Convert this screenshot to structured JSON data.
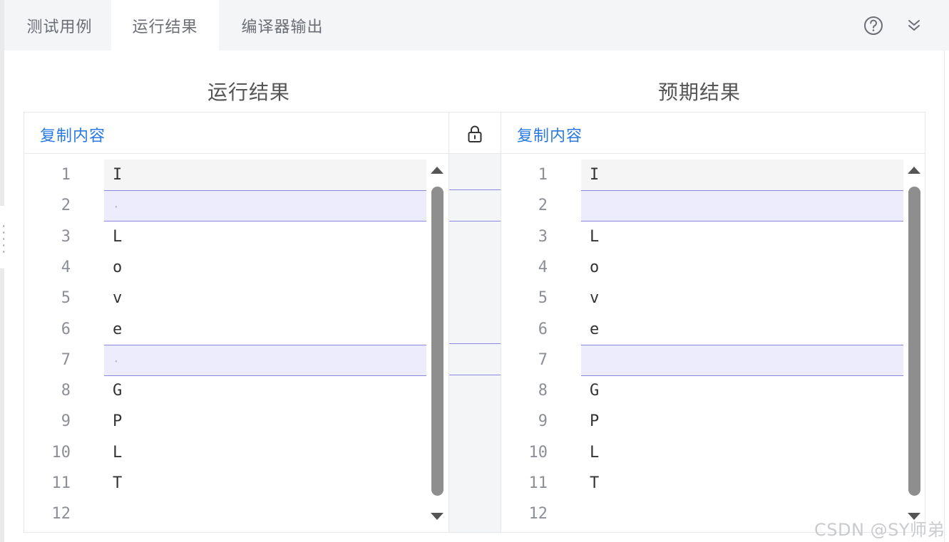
{
  "tabs": [
    {
      "label": "测试用例",
      "active": false
    },
    {
      "label": "运行结果",
      "active": true
    },
    {
      "label": "编译器输出",
      "active": false
    }
  ],
  "toolbar": {
    "help_icon": "question-circle-icon",
    "collapse_icon": "chevrons-down-icon"
  },
  "left_panel": {
    "title": "运行结果",
    "copy_label": "复制内容",
    "lines": [
      {
        "num": "1",
        "text": "I"
      },
      {
        "num": "2",
        "text": "·"
      },
      {
        "num": "3",
        "text": "L"
      },
      {
        "num": "4",
        "text": "o"
      },
      {
        "num": "5",
        "text": "v"
      },
      {
        "num": "6",
        "text": "e"
      },
      {
        "num": "7",
        "text": "·"
      },
      {
        "num": "8",
        "text": "G"
      },
      {
        "num": "9",
        "text": "P"
      },
      {
        "num": "10",
        "text": "L"
      },
      {
        "num": "11",
        "text": "T"
      },
      {
        "num": "12",
        "text": ""
      }
    ]
  },
  "right_panel": {
    "title": "预期结果",
    "copy_label": "复制内容",
    "lines": [
      {
        "num": "1",
        "text": "I"
      },
      {
        "num": "2",
        "text": ""
      },
      {
        "num": "3",
        "text": "L"
      },
      {
        "num": "4",
        "text": "o"
      },
      {
        "num": "5",
        "text": "v"
      },
      {
        "num": "6",
        "text": "e"
      },
      {
        "num": "7",
        "text": ""
      },
      {
        "num": "8",
        "text": "G"
      },
      {
        "num": "9",
        "text": "P"
      },
      {
        "num": "10",
        "text": "L"
      },
      {
        "num": "11",
        "text": "T"
      },
      {
        "num": "12",
        "text": ""
      }
    ]
  },
  "diff_lines": [
    2,
    7
  ],
  "center": {
    "lock_icon": "lock-icon"
  },
  "watermark": "CSDN @SY师弟",
  "colors": {
    "accent": "#2a7ae2",
    "diff_bg": "#edecfc",
    "diff_border": "#8b87e0",
    "tabbar_bg": "#f4f5f7"
  }
}
